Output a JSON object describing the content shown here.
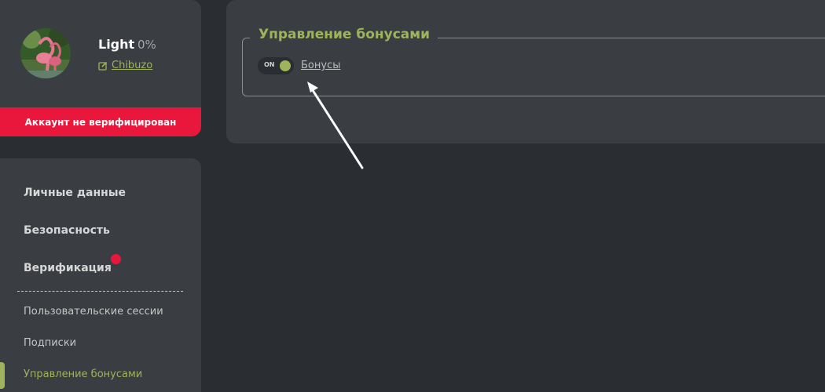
{
  "profile": {
    "username": "Light",
    "progress": "0%",
    "edit_label": "Chibuzo",
    "unverified_label": "Аккаунт не верифицирован"
  },
  "nav": {
    "main": [
      "Личные данные",
      "Безопасность",
      "Верификация"
    ],
    "sub": [
      "Пользовательские сессии",
      "Подписки",
      "Управление бонусами"
    ],
    "active": "Управление бонусами"
  },
  "main": {
    "section_title": "Управление бонусами",
    "toggle_state": "ON",
    "bonus_link": "Бонусы"
  },
  "colors": {
    "accent": "#9fb35a",
    "alert": "#e8173b",
    "panel": "#3a3d42",
    "background": "#2a2d31"
  },
  "icons": [
    "edit-icon",
    "notification-dot",
    "annotation-arrow"
  ]
}
